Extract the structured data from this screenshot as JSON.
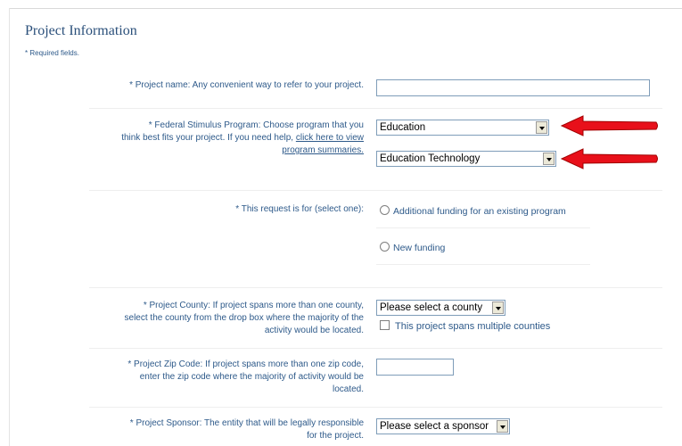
{
  "section": {
    "title": "Project Information",
    "required_note": "* Required fields."
  },
  "fields": {
    "project_name": {
      "label": "* Project name:",
      "hint": "Any convenient way to refer to your project.",
      "value": ""
    },
    "stimulus_program": {
      "label": "* Federal Stimulus Program:",
      "hint_line1": "Choose program that you",
      "hint_line2": "think best fits your project. If you need help,",
      "link_part1": "click here to view",
      "link_part2": "program summaries.",
      "program_value": "Education",
      "subprogram_value": "Education Technology"
    },
    "request_type": {
      "label": "* This request is for (select one):",
      "option1": "Additional funding for an existing program",
      "option2": "New funding"
    },
    "county": {
      "label": "* Project County:",
      "hint_line1": "If project spans more than one county,",
      "hint_line2": "select the county from the drop box where the majority of the",
      "hint_line3": "activity would be located.",
      "select_value": "Please select a county",
      "checkbox_label": "This project spans multiple counties"
    },
    "zip": {
      "label": "* Project Zip Code:",
      "hint_line1": "If project spans more than one zip code,",
      "hint_line2": "enter the zip code where the majority of activity would be",
      "hint_line3": "located.",
      "value": ""
    },
    "sponsor": {
      "label": "* Project Sponsor:",
      "hint_line1": "The entity that will be legally responsible",
      "hint_line2": "for the project.",
      "select_value": "Please select a sponsor"
    }
  },
  "annotations": {
    "arrow_color": "#e8101a"
  }
}
